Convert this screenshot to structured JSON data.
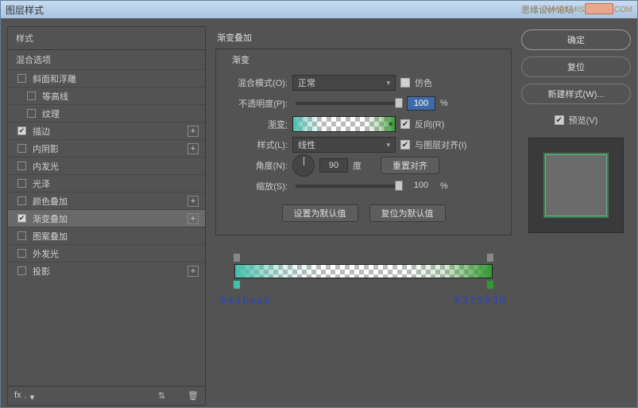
{
  "titlebar": {
    "title": "图层样式",
    "watermark1": "思缘设计论坛",
    "watermark2": "WWW.MISSYUAN.COM"
  },
  "left": {
    "header": "样式",
    "subheader": "混合选项",
    "items": [
      {
        "label": "斜面和浮雕",
        "checked": false,
        "plus": false,
        "indent": false
      },
      {
        "label": "等高线",
        "checked": false,
        "plus": false,
        "indent": true
      },
      {
        "label": "纹理",
        "checked": false,
        "plus": false,
        "indent": true
      },
      {
        "label": "描边",
        "checked": true,
        "plus": true,
        "indent": false
      },
      {
        "label": "内阴影",
        "checked": false,
        "plus": true,
        "indent": false
      },
      {
        "label": "内发光",
        "checked": false,
        "plus": false,
        "indent": false
      },
      {
        "label": "光泽",
        "checked": false,
        "plus": false,
        "indent": false
      },
      {
        "label": "颜色叠加",
        "checked": false,
        "plus": true,
        "indent": false
      },
      {
        "label": "渐变叠加",
        "checked": true,
        "plus": true,
        "indent": false,
        "selected": true
      },
      {
        "label": "图案叠加",
        "checked": false,
        "plus": false,
        "indent": false
      },
      {
        "label": "外发光",
        "checked": false,
        "plus": false,
        "indent": false
      },
      {
        "label": "投影",
        "checked": false,
        "plus": true,
        "indent": false
      }
    ],
    "fx": "fx"
  },
  "center": {
    "title": "渐变叠加",
    "legend": "渐变",
    "blend_label": "混合模式(O):",
    "blend_value": "正常",
    "dither": "仿色",
    "opacity_label": "不透明度(P):",
    "opacity_value": "100",
    "pct": "%",
    "grad_label": "渐变:",
    "reverse": "反向(R)",
    "style_label": "样式(L):",
    "style_value": "线性",
    "align": "与图层对齐(I)",
    "angle_label": "角度(N):",
    "angle_value": "90",
    "deg": "度",
    "reset_align": "重置对齐",
    "scale_label": "缩放(S):",
    "scale_value": "100",
    "set_default": "设置为默认值",
    "reset_default": "复位为默认值",
    "hex_left": "#44beab",
    "hex_right": "#329930"
  },
  "right": {
    "ok": "确定",
    "reset": "复位",
    "new_style": "新建样式(W)...",
    "preview": "预览(V)"
  }
}
